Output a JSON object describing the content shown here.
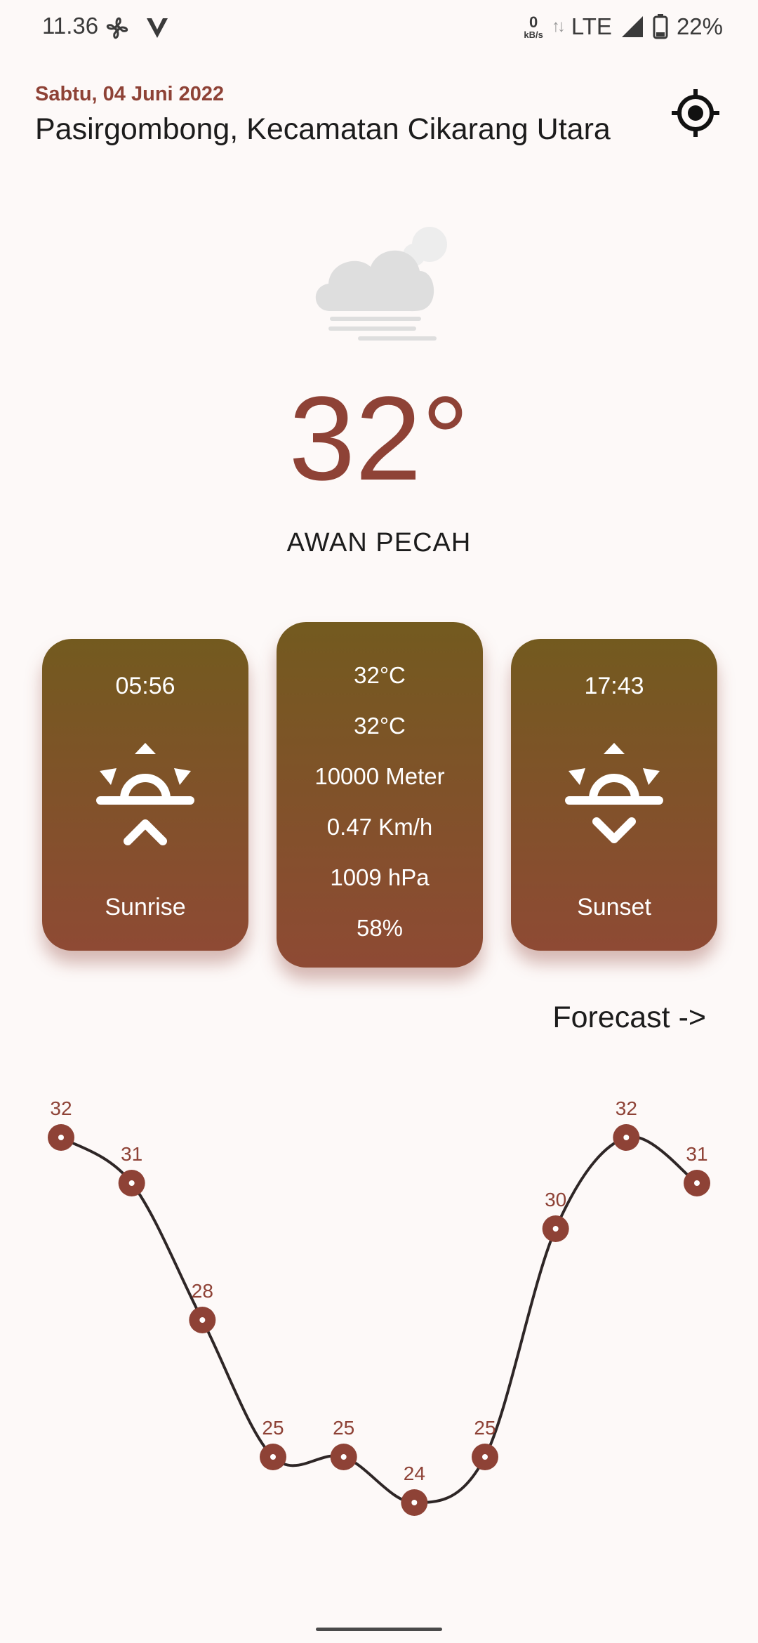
{
  "status_bar": {
    "time": "11.36",
    "net_speed_value": "0",
    "net_speed_unit": "kB/s",
    "network": "LTE",
    "battery": "22%",
    "icons": [
      "fan-icon",
      "v-logo-icon",
      "data-arrows-icon",
      "signal-icon",
      "battery-icon"
    ]
  },
  "header": {
    "date": "Sabtu, 04 Juni 2022",
    "location": "Pasirgombong, Kecamatan Cikarang Utara",
    "location_icon": "target-location-icon"
  },
  "current": {
    "icon": "cloud-fog-icon",
    "temperature": "32°",
    "description": "AWAN PECAH"
  },
  "cards": {
    "sunrise": {
      "time": "05:56",
      "label": "Sunrise",
      "icon": "sunrise-icon"
    },
    "details": [
      "32°C",
      "32°C",
      "10000 Meter",
      "0.47 Km/h",
      "1009 hPa",
      "58%"
    ],
    "sunset": {
      "time": "17:43",
      "label": "Sunset",
      "icon": "sunset-icon"
    }
  },
  "forecast_link": "Forecast ->",
  "colors": {
    "accent": "#8e4236",
    "card_top": "#735a1f",
    "card_bottom": "#8e4a34",
    "background": "#fdf9f8"
  },
  "chart_data": {
    "type": "line",
    "title": "",
    "xlabel": "",
    "ylabel": "",
    "values": [
      32,
      31,
      28,
      25,
      25,
      24,
      25,
      30,
      32,
      31
    ],
    "ylim": [
      24,
      32
    ],
    "grid": false
  }
}
